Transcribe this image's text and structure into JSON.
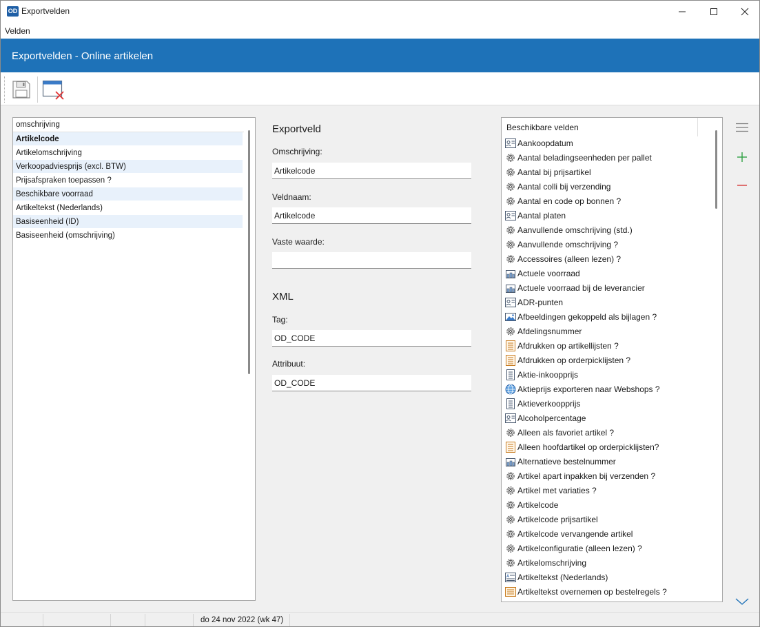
{
  "window": {
    "app_logo": "OD",
    "title": "Exportvelden"
  },
  "menu": {
    "items": [
      "Velden"
    ]
  },
  "banner": {
    "title": "Exportvelden - Online artikelen"
  },
  "toolbar": {
    "buttons": [
      {
        "name": "save",
        "icon": "floppy-disk-icon"
      },
      {
        "name": "close",
        "icon": "close-window-icon"
      }
    ]
  },
  "left_list": {
    "header": "omschrijving",
    "rows": [
      "Artikelcode",
      "Artikelomschrijving",
      "Verkoopadviesprijs (excl. BTW)",
      "Prijsafspraken toepassen ?",
      "Beschikbare voorraad",
      "Artikeltekst (Nederlands)",
      "Basiseenheid (ID)",
      "Basiseenheid (omschrijving)"
    ],
    "selected_index": 0
  },
  "form": {
    "exportveld_title": "Exportveld",
    "omschrijving_label": "Omschrijving:",
    "omschrijving_value": "Artikelcode",
    "veldnaam_label": "Veldnaam:",
    "veldnaam_value": "Artikelcode",
    "vaste_waarde_label": "Vaste waarde:",
    "vaste_waarde_value": "",
    "xml_title": "XML",
    "tag_label": "Tag:",
    "tag_value": "OD_CODE",
    "attribuut_label": "Attribuut:",
    "attribuut_value": "OD_CODE"
  },
  "available_fields": {
    "header": "Beschikbare velden",
    "items": [
      {
        "label": "Aankoopdatum",
        "icon": "card-icon"
      },
      {
        "label": "Aantal beladingseenheden per pallet",
        "icon": "gear-icon"
      },
      {
        "label": "Aantal bij prijsartikel",
        "icon": "gear-icon"
      },
      {
        "label": "Aantal colli bij verzending",
        "icon": "gear-icon"
      },
      {
        "label": "Aantal en code op bonnen ?",
        "icon": "gear-icon"
      },
      {
        "label": "Aantal platen",
        "icon": "card-icon"
      },
      {
        "label": "Aanvullende omschrijving (std.)",
        "icon": "gear-icon"
      },
      {
        "label": "Aanvullende omschrijving ?",
        "icon": "gear-icon"
      },
      {
        "label": "Accessoires (alleen lezen) ?",
        "icon": "gear-icon"
      },
      {
        "label": "Actuele voorraad",
        "icon": "warehouse-icon"
      },
      {
        "label": "Actuele voorraad bij de leverancier",
        "icon": "warehouse-icon"
      },
      {
        "label": "ADR-punten",
        "icon": "card-icon"
      },
      {
        "label": "Afbeeldingen gekoppeld als bijlagen ?",
        "icon": "image-icon"
      },
      {
        "label": "Afdelingsnummer",
        "icon": "gear-icon"
      },
      {
        "label": "Afdrukken op artikellijsten ?",
        "icon": "printer-list-icon"
      },
      {
        "label": "Afdrukken op orderpicklijsten ?",
        "icon": "printer-list-icon"
      },
      {
        "label": "Aktie-inkoopprijs",
        "icon": "document-icon"
      },
      {
        "label": "Aktieprijs exporteren naar Webshops ?",
        "icon": "globe-icon"
      },
      {
        "label": "Aktieverkoopprijs",
        "icon": "document-icon"
      },
      {
        "label": "Alcoholpercentage",
        "icon": "card-icon"
      },
      {
        "label": "Alleen als favoriet artikel ?",
        "icon": "gear-icon"
      },
      {
        "label": "Alleen hoofdartikel op orderpicklijsten?",
        "icon": "printer-list-icon"
      },
      {
        "label": "Alternatieve bestelnummer",
        "icon": "warehouse-icon"
      },
      {
        "label": "Artikel apart inpakken bij verzenden ?",
        "icon": "gear-icon"
      },
      {
        "label": "Artikel met variaties ?",
        "icon": "gear-icon"
      },
      {
        "label": "Artikelcode",
        "icon": "gear-icon"
      },
      {
        "label": "Artikelcode prijsartikel",
        "icon": "gear-icon"
      },
      {
        "label": "Artikelcode vervangende artikel",
        "icon": "gear-icon"
      },
      {
        "label": "Artikelconfiguratie (alleen lezen) ?",
        "icon": "gear-icon"
      },
      {
        "label": "Artikelomschrijving",
        "icon": "gear-icon"
      },
      {
        "label": "Artikeltekst (Nederlands)",
        "icon": "text-card-icon"
      },
      {
        "label": "Artikeltekst overnemen op bestelregels ?",
        "icon": "orange-list-icon"
      }
    ]
  },
  "side_buttons": [
    {
      "name": "menu",
      "icon": "hamburger-icon"
    },
    {
      "name": "add",
      "icon": "plus-icon",
      "color": "#2ea043"
    },
    {
      "name": "remove",
      "icon": "minus-icon",
      "color": "#d73a3a"
    },
    {
      "name": "scroll-down",
      "icon": "chevron-down-icon",
      "color": "#1e72b8"
    }
  ],
  "status": {
    "date_text": "do 24 nov 2022 (wk 47)"
  },
  "colors": {
    "banner": "#1e72b8",
    "row_alt": "#e8f1fb"
  }
}
